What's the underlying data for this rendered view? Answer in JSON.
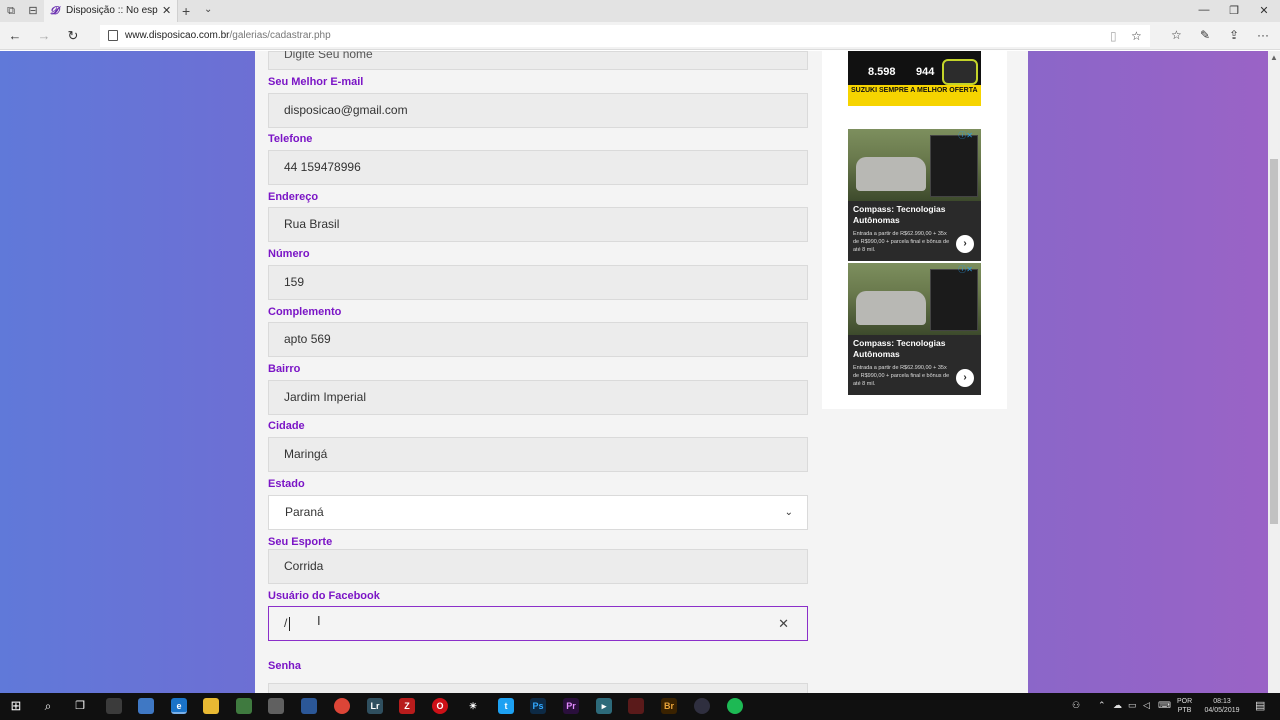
{
  "browser": {
    "tab_title": "Disposição :: No esporte",
    "tab_favicon": "𝓓",
    "url_domain": "www.disposicao.com.br",
    "url_path": "/galerias/cadastrar.php"
  },
  "form": {
    "nome_placeholder": "Digite Seu nome",
    "email": {
      "label": "Seu Melhor E-mail",
      "value": "disposicao@gmail.com"
    },
    "telefone": {
      "label": "Telefone",
      "value": "44 159478996"
    },
    "endereco": {
      "label": "Endereço",
      "value": "Rua Brasil"
    },
    "numero": {
      "label": "Número",
      "value": "159"
    },
    "complemento": {
      "label": "Complemento",
      "value": "apto 569"
    },
    "bairro": {
      "label": "Bairro",
      "value": "Jardim Imperial"
    },
    "cidade": {
      "label": "Cidade",
      "value": "Maringá"
    },
    "estado": {
      "label": "Estado",
      "value": "Paraná"
    },
    "esporte": {
      "label": "Seu Esporte",
      "value": "Corrida"
    },
    "facebook": {
      "label": "Usuário do Facebook",
      "value": "/"
    },
    "senha": {
      "label": "Senha"
    }
  },
  "ads": {
    "moto": {
      "price_1": "8.598",
      "price_2": "944",
      "tagline": "SUZUKI SEMPRE A MELHOR OFERTA"
    },
    "car_1": {
      "title": "Compass: Tecnologias Autônomas",
      "desc": "Entrada a partir de R$62.990,00 + 35x de R$990,00 + parcela final e bônus de até 8 mil."
    },
    "car_2": {
      "title": "Compass: Tecnologias Autônomas",
      "desc": "Entrada a partir de R$62.990,00 + 35x de R$990,00 + parcela final e bônus de até 8 mil."
    }
  },
  "taskbar": {
    "lang_1": "POR",
    "lang_2": "PTB",
    "time": "08:13",
    "date": "04/05/2019"
  },
  "colors": {
    "label_purple": "#7b15c6",
    "gradient_left": "#6079d9",
    "gradient_right": "#9a63c6"
  }
}
